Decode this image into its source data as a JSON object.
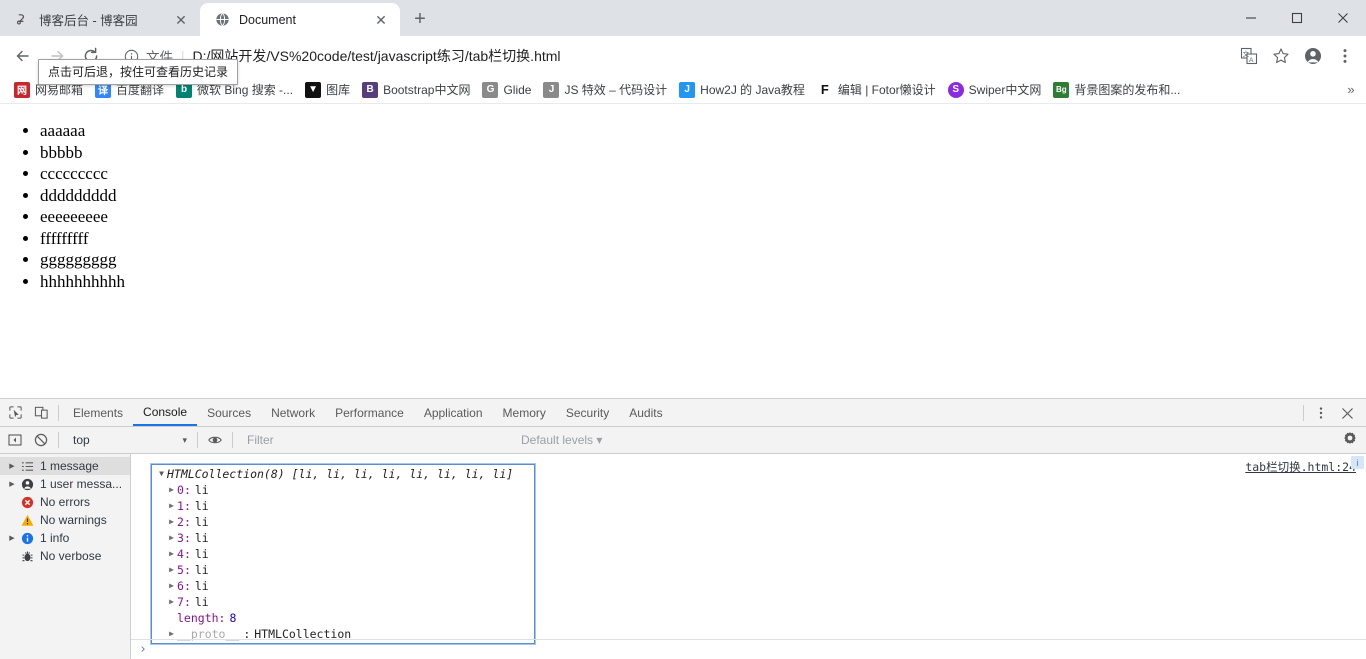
{
  "window": {
    "controls": [
      {
        "name": "minimize-button",
        "glyph": "minimize"
      },
      {
        "name": "maximize-button",
        "glyph": "maximize"
      },
      {
        "name": "close-button",
        "glyph": "close"
      }
    ]
  },
  "tabs": [
    {
      "title": "博客后台 - 博客园",
      "icon": "bookmark-site-icon",
      "active": false,
      "close_label": "✕"
    },
    {
      "title": "Document",
      "icon": "globe-icon",
      "active": true,
      "close_label": "✕"
    }
  ],
  "new_tab_label": "+",
  "toolbar": {
    "back_label": "←",
    "forward_label": "→",
    "reload_label": "⟳",
    "info_icon": "info-circle-icon",
    "scheme_label": "文件",
    "url": "D:/网站开发/VS%20code/test/javascript练习/tab栏切换.html",
    "translate_icon": "translate-icon",
    "bookmark_star_icon": "star-icon",
    "profile_icon": "account-circle-icon",
    "menu_icon": "three-dot-menu-icon"
  },
  "tooltip": {
    "text": "点击可后退，按住可查看历史记录"
  },
  "bookmarks": {
    "items": [
      {
        "label": "网易邮箱",
        "icon_text": "网",
        "icon_color": "#c9252c"
      },
      {
        "label": "百度翻译",
        "icon_text": "译",
        "icon_color": "#3385ff"
      },
      {
        "label": "微软 Bing 搜索 -...",
        "icon_text": "b",
        "icon_color": "#008373"
      },
      {
        "label": "图库",
        "icon_text": "▼",
        "icon_color": "#111111"
      },
      {
        "label": "Bootstrap中文网",
        "icon_text": "B",
        "icon_color": "#563d7c"
      },
      {
        "label": "Glide",
        "icon_text": "G",
        "icon_color": "#8a8a8a"
      },
      {
        "label": "JS 特效 – 代码设计",
        "icon_text": "J",
        "icon_color": "#8a8a8a"
      },
      {
        "label": "How2J 的 Java教程",
        "icon_text": "J",
        "icon_color": "#2196f3"
      },
      {
        "label": "编辑 | Fotor懒设计",
        "icon_text": "F",
        "icon_color": "#111111"
      },
      {
        "label": "Swiper中文网",
        "icon_text": "S",
        "icon_color": "#8a2be2"
      },
      {
        "label": "背景图案的发布和...",
        "icon_text": "Bg",
        "icon_color": "#2e7d32"
      }
    ],
    "overflow_label": "»"
  },
  "page": {
    "list_items": [
      "aaaaaa",
      "bbbbb",
      "ccccccccc",
      "ddddddddd",
      "eeeeeeeee",
      "fffffffff",
      "ggggggggg",
      "hhhhhhhhhh"
    ]
  },
  "devtools": {
    "inspect_icon": "inspect-element-icon",
    "device_icon": "device-toolbar-icon",
    "tabs": [
      {
        "label": "Elements",
        "active": false
      },
      {
        "label": "Console",
        "active": true
      },
      {
        "label": "Sources",
        "active": false
      },
      {
        "label": "Network",
        "active": false
      },
      {
        "label": "Performance",
        "active": false
      },
      {
        "label": "Application",
        "active": false
      },
      {
        "label": "Memory",
        "active": false
      },
      {
        "label": "Security",
        "active": false
      },
      {
        "label": "Audits",
        "active": false
      }
    ],
    "more_icon": "three-dot-menu-icon",
    "close_icon": "close-icon",
    "filterbar": {
      "sidebar_toggle_icon": "show-console-sidebar-icon",
      "clear_icon": "clear-console-icon",
      "context": "top",
      "context_caret": "▾",
      "eye_icon": "live-expression-icon",
      "filter_placeholder": "Filter",
      "levels_label": "Default levels",
      "levels_caret": "▾",
      "settings_icon": "gear-icon"
    },
    "sidebar": [
      {
        "label": "1 message",
        "icon": "list-icon",
        "expandable": true,
        "selected": true
      },
      {
        "label": "1 user messa...",
        "icon": "user-icon",
        "expandable": true,
        "selected": false
      },
      {
        "label": "No errors",
        "icon": "error-icon",
        "expandable": false,
        "selected": false
      },
      {
        "label": "No warnings",
        "icon": "warning-icon",
        "expandable": false,
        "selected": false
      },
      {
        "label": "1 info",
        "icon": "info-icon",
        "expandable": true,
        "selected": false
      },
      {
        "label": "No verbose",
        "icon": "verbose-bug-icon",
        "expandable": false,
        "selected": false
      }
    ],
    "console": {
      "source_link": "tab栏切换.html:24",
      "object_header": "HTMLCollection(8) [li, li, li, li, li, li, li, li]",
      "info_badge": "i",
      "entries": [
        {
          "key": "0",
          "value": "li"
        },
        {
          "key": "1",
          "value": "li"
        },
        {
          "key": "2",
          "value": "li"
        },
        {
          "key": "3",
          "value": "li"
        },
        {
          "key": "4",
          "value": "li"
        },
        {
          "key": "5",
          "value": "li"
        },
        {
          "key": "6",
          "value": "li"
        },
        {
          "key": "7",
          "value": "li"
        }
      ],
      "length_key": "length:",
      "length_value": "8",
      "proto_key": "__proto__",
      "proto_sep": ":",
      "proto_value": "HTMLCollection",
      "prompt_caret": "›"
    }
  },
  "colors": {
    "accent": "#1a73e8",
    "tabstrip_bg": "#dee1e6",
    "devtools_bg": "#f3f3f3",
    "object_border": "#5b8bd0",
    "prop_key": "#881391",
    "number": "#1c00cf"
  }
}
